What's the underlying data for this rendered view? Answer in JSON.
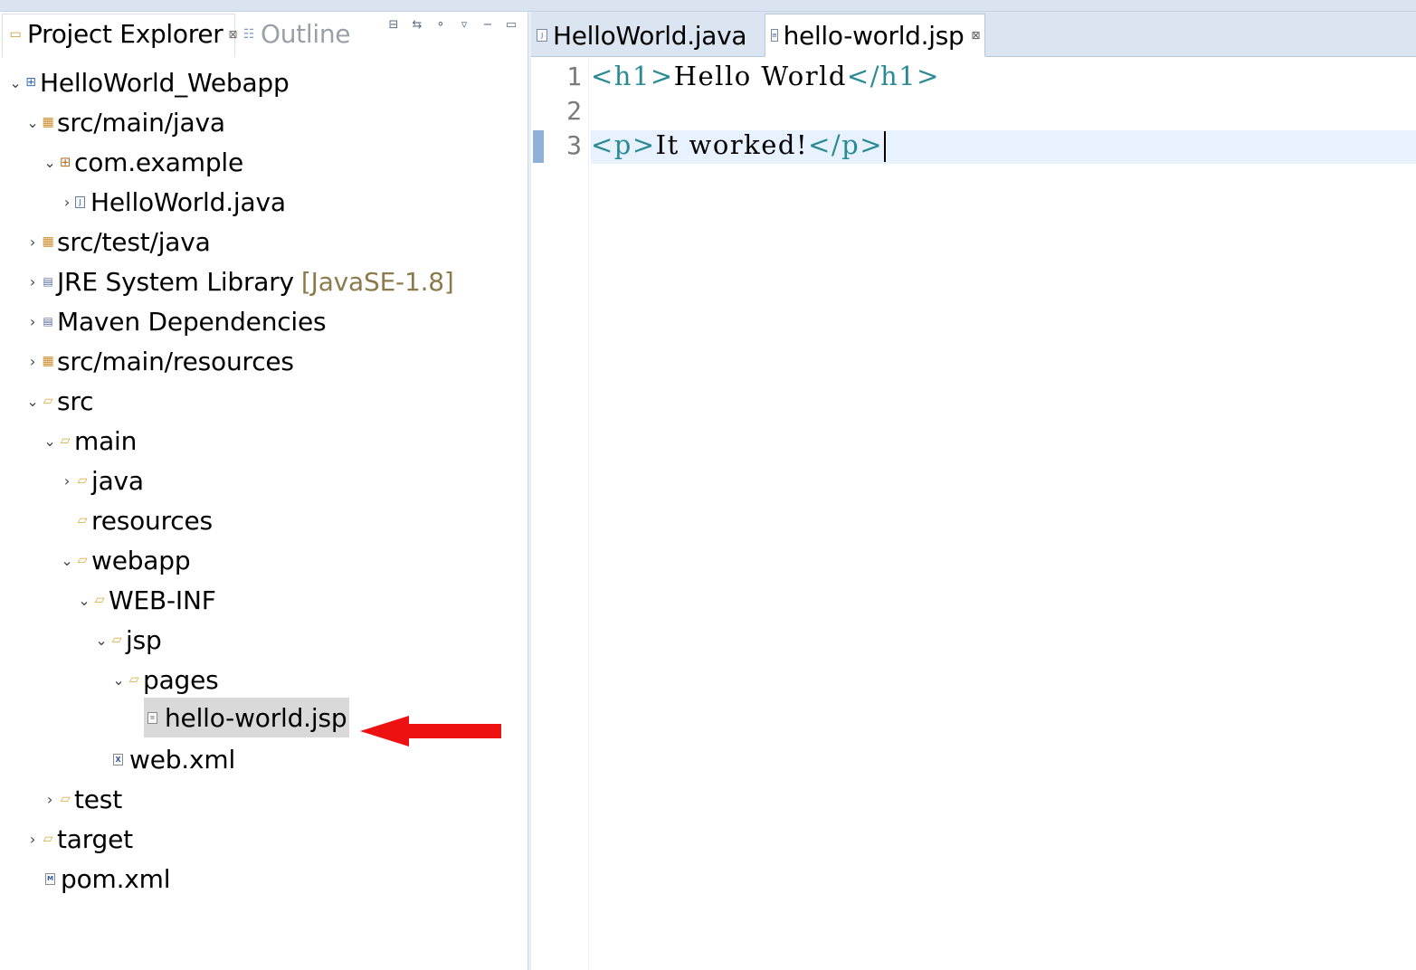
{
  "views": {
    "project_explorer_label": "Project Explorer",
    "outline_label": "Outline",
    "close_glyph": "⊠"
  },
  "tree": {
    "project": "HelloWorld_Webapp",
    "src_main_java": "src/main/java",
    "com_example": "com.example",
    "helloworld_java": "HelloWorld.java",
    "src_test_java": "src/test/java",
    "jre_lib": "JRE System Library",
    "jre_version": "[JavaSE-1.8]",
    "maven_deps": "Maven Dependencies",
    "src_main_resources": "src/main/resources",
    "src": "src",
    "main": "main",
    "java": "java",
    "resources": "resources",
    "webapp": "webapp",
    "web_inf": "WEB-INF",
    "jsp": "jsp",
    "pages": "pages",
    "hello_world_jsp": "hello-world.jsp",
    "web_xml": "web.xml",
    "test": "test",
    "target": "target",
    "pom_xml": "pom.xml"
  },
  "editor": {
    "tabs": [
      {
        "label": "HelloWorld.java",
        "active": false
      },
      {
        "label": "hello-world.jsp",
        "active": true
      }
    ],
    "lines": [
      {
        "num": "1",
        "open": "<h1>",
        "text": "Hello World",
        "close": "</h1>"
      },
      {
        "num": "2",
        "open": "",
        "text": "",
        "close": ""
      },
      {
        "num": "3",
        "open": "<p>",
        "text": "It worked!",
        "close": "</p>"
      }
    ]
  },
  "colors": {
    "tag": "#2a8a94",
    "current_line": "#e8f2fe",
    "selection": "#d9d9d9",
    "arrow": "#ee1111"
  }
}
